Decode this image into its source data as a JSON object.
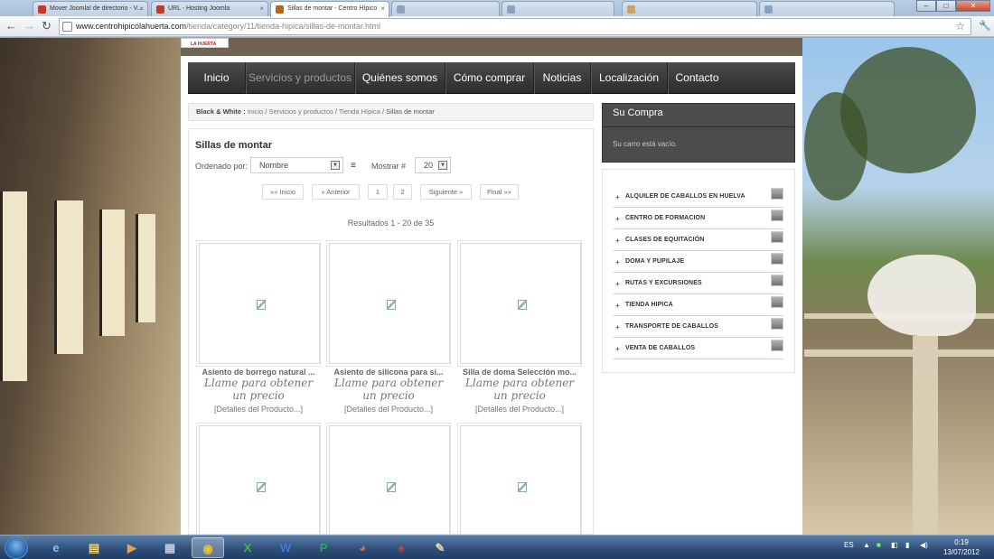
{
  "browser": {
    "tabs": [
      {
        "title": "Mover Joomla! de directorio - V...",
        "active": false
      },
      {
        "title": "URL - Hosting Joomla",
        "active": false
      },
      {
        "title": "Sillas de montar - Centro Hípico",
        "active": true
      },
      {
        "title": "",
        "active": false
      },
      {
        "title": "",
        "active": false
      },
      {
        "title": "",
        "active": false
      },
      {
        "title": "",
        "active": false
      }
    ],
    "url_domain": "www.centrohipicolahuerta.com",
    "url_path": "/tienda/category/11/tienda-hipica/sillas-de-montar.html"
  },
  "site": {
    "logo_text": "LA HUERTA",
    "nav": [
      {
        "label": "Inicio",
        "current": false
      },
      {
        "label": "Servicios y productos",
        "current": true
      },
      {
        "label": "Quiénes somos",
        "current": false
      },
      {
        "label": "Cómo comprar",
        "current": false
      },
      {
        "label": "Noticias",
        "current": false
      },
      {
        "label": "Localización",
        "current": false
      },
      {
        "label": "Contacto",
        "current": false
      }
    ],
    "breadcrumb": {
      "label": "Black & White :",
      "links": [
        "Inicio",
        "Servicios y productos",
        "Tienda Hípica"
      ],
      "current": "Sillas de montar"
    }
  },
  "category": {
    "title": "Sillas de montar",
    "order_label": "Ordenado por:",
    "order_value": "Nombre",
    "show_label": "Mostrar #",
    "show_value": "20",
    "pagination": [
      "«« Inicio",
      "« Anterior",
      "1",
      "2",
      "Siguiente »",
      "Final »»"
    ],
    "results": "Resultados 1 - 20 de 35",
    "products": [
      {
        "name": "Asiento de borrego natural ...",
        "price": "Llame para obtener un precio",
        "details": "[Detalles del Producto...]"
      },
      {
        "name": "Asiento de silicona para si...",
        "price": "Llame para obtener un precio",
        "details": "[Detalles del Producto...]"
      },
      {
        "name": "Silla de doma Selección mo...",
        "price": "Llame para obtener un precio",
        "details": "[Detalles del Producto...]"
      }
    ]
  },
  "sidebar": {
    "cart_title": "Su Compra",
    "cart_empty": "Su carro está vacío.",
    "menu": [
      "ALQUILER DE CABALLOS EN HUELVA",
      "CENTRO DE FORMACION",
      "CLASES DE EQUITACIÓN",
      "DOMA Y PUPILAJE",
      "RUTAS Y EXCURSIONES",
      "TIENDA HIPICA",
      "TRANSPORTE DE CABALLOS",
      "VENTA DE CABALLOS"
    ]
  },
  "taskbar": {
    "language": "ES",
    "time": "0:19",
    "date": "13/07/2012"
  },
  "colors": {
    "nav_bg": "#333333",
    "cart_bg": "#4c4c4c",
    "taskbar": "#2c4d78"
  }
}
